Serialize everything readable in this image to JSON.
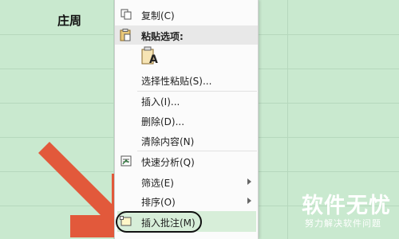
{
  "sheet": {
    "cell_text": "庄周"
  },
  "menu": {
    "copy": "复制(C)",
    "paste_options": "粘贴选项:",
    "paste_glyph": "A",
    "paste_special": "选择性粘贴(S)...",
    "insert": "插入(I)...",
    "delete": "删除(D)...",
    "clear_contents": "清除内容(N)",
    "quick_analysis": "快速分析(Q)",
    "filter": "筛选(E)",
    "sort": "排序(O)",
    "insert_comment": "插入批注(M)"
  },
  "watermark": {
    "brand": "软件无忧",
    "tagline": "努力解决软件问题"
  },
  "colors": {
    "sheet_bg": "#c9e9cf",
    "arrow": "#e2593b",
    "highlight": "#d7eed9"
  }
}
